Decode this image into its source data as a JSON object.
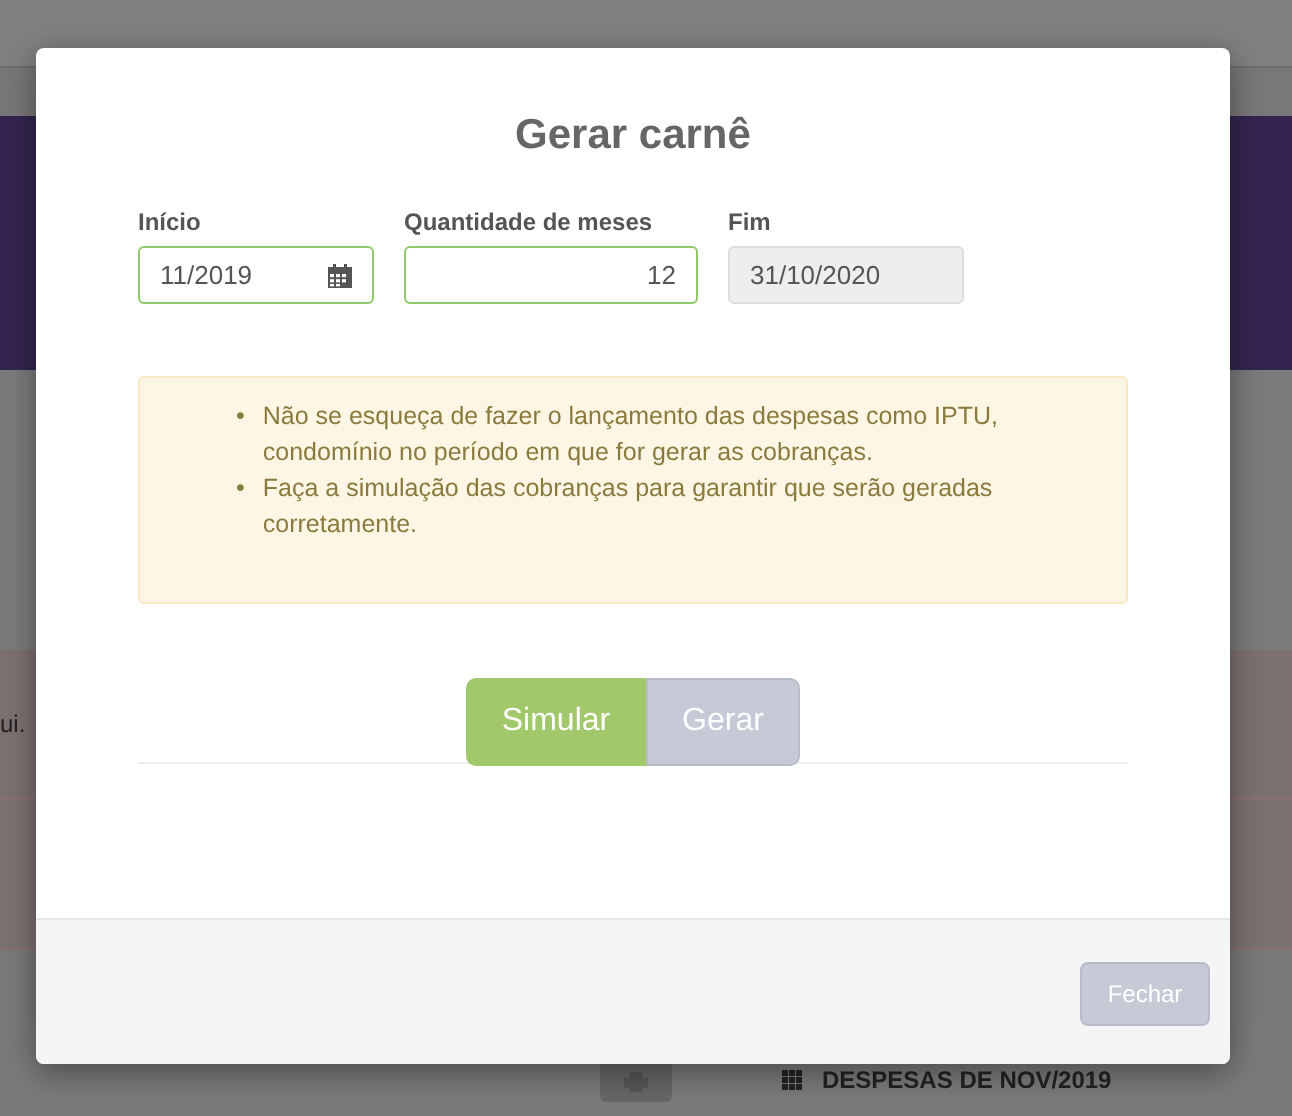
{
  "background": {
    "row_text": "ui.",
    "section_title": "DESPESAS DE NOV/2019"
  },
  "modal": {
    "title": "Gerar carnê",
    "fields": [
      {
        "kind": "month",
        "label": "Início",
        "value": "11/2019",
        "disabled": false
      },
      {
        "kind": "number",
        "label": "Quantidade de meses",
        "value": "12",
        "disabled": false
      },
      {
        "kind": "date",
        "label": "Fim",
        "value": "31/10/2020",
        "disabled": true
      }
    ],
    "notes": [
      {
        "bullet": "•",
        "text": "Não se esqueça de fazer o lançamento das despesas como IPTU, condomínio no período em que for gerar as cobranças."
      },
      {
        "bullet": "•",
        "text": "Faça a simulação das cobranças para garantir que serão geradas corretamente."
      }
    ],
    "actions": [
      {
        "label": "Simular",
        "kind": "primary"
      },
      {
        "label": "Gerar",
        "kind": "secondary"
      }
    ],
    "footer_button": "Fechar"
  }
}
